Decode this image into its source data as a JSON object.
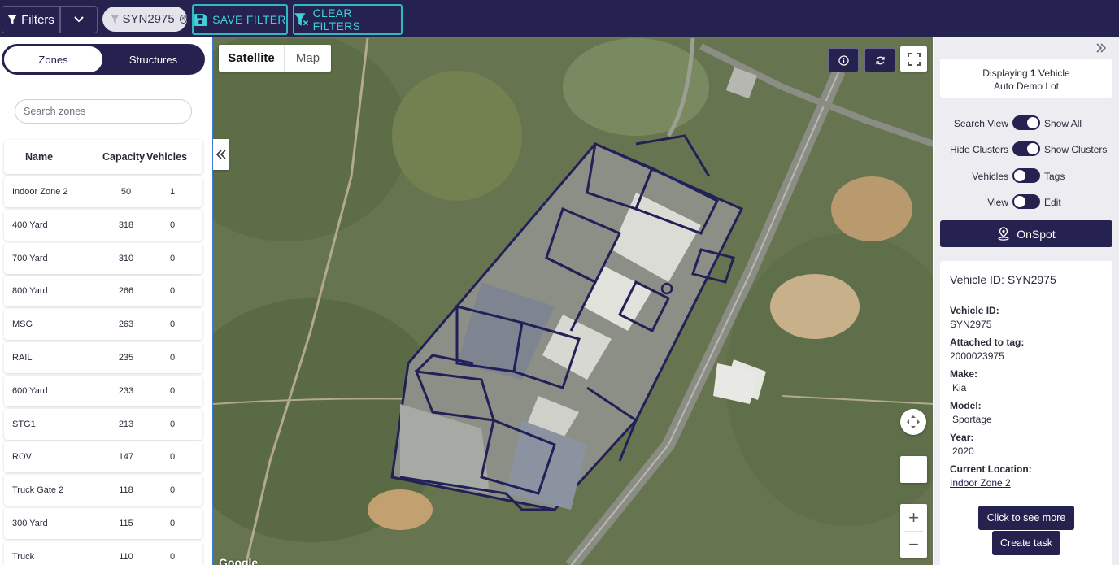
{
  "topbar": {
    "filters_label": "Filters",
    "filter_chip": "SYN2975",
    "save_filter": "SAVE FILTER",
    "clear_filters": "CLEAR FILTERS"
  },
  "left": {
    "tabs": {
      "zones": "Zones",
      "structures": "Structures",
      "selected": "Zones"
    },
    "search_placeholder": "Search zones",
    "table": {
      "headers": {
        "name": "Name",
        "capacity": "Capacity",
        "vehicles": "Vehicles"
      },
      "rows": [
        {
          "name": "Indoor Zone 2",
          "capacity": "50",
          "vehicles": "1"
        },
        {
          "name": "400 Yard",
          "capacity": "318",
          "vehicles": "0"
        },
        {
          "name": "700 Yard",
          "capacity": "310",
          "vehicles": "0"
        },
        {
          "name": "800 Yard",
          "capacity": "266",
          "vehicles": "0"
        },
        {
          "name": "MSG",
          "capacity": "263",
          "vehicles": "0"
        },
        {
          "name": "RAIL",
          "capacity": "235",
          "vehicles": "0"
        },
        {
          "name": "600 Yard",
          "capacity": "233",
          "vehicles": "0"
        },
        {
          "name": "STG1",
          "capacity": "213",
          "vehicles": "0"
        },
        {
          "name": "ROV",
          "capacity": "147",
          "vehicles": "0"
        },
        {
          "name": "Truck Gate 2",
          "capacity": "118",
          "vehicles": "0"
        },
        {
          "name": "300 Yard",
          "capacity": "115",
          "vehicles": "0"
        },
        {
          "name": "Truck",
          "capacity": "110",
          "vehicles": "0"
        }
      ]
    }
  },
  "map": {
    "type_satellite": "Satellite",
    "type_map": "Map",
    "selected_type": "Satellite",
    "attribution": "Google",
    "icons": [
      "info-icon",
      "refresh-icon",
      "fullscreen-icon",
      "pan-icon",
      "zoom-in-icon",
      "zoom-out-icon"
    ]
  },
  "right": {
    "displaying": {
      "prefix": "Displaying",
      "count": "1",
      "suffix": "Vehicle",
      "lot": "Auto Demo Lot"
    },
    "toggles": [
      {
        "left": "Search View",
        "right": "Show All",
        "state": "right"
      },
      {
        "left": "Hide Clusters",
        "right": "Show Clusters",
        "state": "right"
      },
      {
        "left": "Vehicles",
        "right": "Tags",
        "state": "left"
      },
      {
        "left": "View",
        "right": "Edit",
        "state": "left"
      }
    ],
    "onspot": "OnSpot",
    "vehicle": {
      "title": "Vehicle ID: SYN2975",
      "id_label": "Vehicle ID:",
      "id": "SYN2975",
      "tag_label": "Attached to tag:",
      "tag": "2000023975",
      "make_label": "Make:",
      "make": "Kia",
      "model_label": "Model:",
      "model": "Sportage",
      "year_label": "Year:",
      "year": "2020",
      "location_label": "Current Location:",
      "location": "Indoor Zone 2"
    },
    "see_more": "Click to see more",
    "create_task": "Create task"
  },
  "colors": {
    "navy": "#25224f",
    "teal": "#2fb8c0",
    "zone_outline": "#1f1a5c"
  }
}
